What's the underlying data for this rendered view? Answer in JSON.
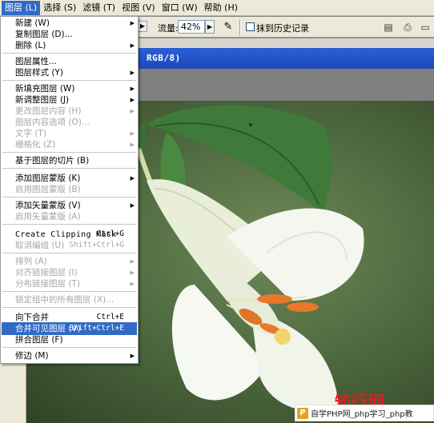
{
  "menubar": {
    "items": [
      {
        "label": "图层 (L)"
      },
      {
        "label": "选择 (S)"
      },
      {
        "label": "滤镜 (T)"
      },
      {
        "label": "视图 (V)"
      },
      {
        "label": "窗口 (W)"
      },
      {
        "label": "帮助 (H)"
      }
    ]
  },
  "toolbar": {
    "flow_label": "流量:",
    "flow_value": "42%",
    "erase_label": "抹到历史记录"
  },
  "document": {
    "title_suffix": "RGB/8)"
  },
  "layer_menu": {
    "items": [
      {
        "label": "新建 (W)",
        "submenu": true
      },
      {
        "label": "复制图层 (D)..."
      },
      {
        "label": "删除 (L)",
        "submenu": true
      },
      {
        "label": "图层属性..."
      },
      {
        "label": "图层样式 (Y)",
        "submenu": true
      },
      {
        "label": "新填充图层 (W)",
        "submenu": true
      },
      {
        "label": "新调整图层 (J)",
        "submenu": true
      },
      {
        "label": "更改图层内容 (H)",
        "submenu": true,
        "disabled": true
      },
      {
        "label": "图层内容选项 (O)...",
        "disabled": true
      },
      {
        "label": "文字 (T)",
        "submenu": true,
        "disabled": true
      },
      {
        "label": "栅格化 (Z)",
        "submenu": true,
        "disabled": true
      },
      {
        "label": "基于图层的切片 (B)"
      },
      {
        "label": "添加图层蒙版 (K)",
        "submenu": true
      },
      {
        "label": "启用图层蒙版 (B)",
        "disabled": true
      },
      {
        "label": "添加矢量蒙版 (V)",
        "submenu": true
      },
      {
        "label": "启用矢量蒙版 (A)",
        "disabled": true
      },
      {
        "label": "Create Clipping Mask",
        "shortcut": "Ctrl+G"
      },
      {
        "label": "取消编组 (U)",
        "shortcut": "Shift+Ctrl+G",
        "disabled": true
      },
      {
        "label": "排列 (A)",
        "submenu": true,
        "disabled": true
      },
      {
        "label": "对齐链接图层 (I)",
        "submenu": true,
        "disabled": true
      },
      {
        "label": "分布链接图层 (T)",
        "submenu": true,
        "disabled": true
      },
      {
        "label": "锁定组中的所有图层 (X)...",
        "disabled": true
      },
      {
        "label": "向下合并",
        "shortcut": "Ctrl+E"
      },
      {
        "label": "合并可见图层 (V)",
        "shortcut": "Shift+Ctrl+E",
        "highlighted": true
      },
      {
        "label": "拼合图层 (F)"
      },
      {
        "label": "修边 (M)",
        "submenu": true
      }
    ]
  },
  "watermark": {
    "title": "知行网",
    "logo": "P",
    "text": "自学PHP网_php学习_php教"
  },
  "colors": {
    "menu_highlight": "#316ac5",
    "titlebar": "#2a5fd8",
    "watermark_red": "#e02020"
  }
}
